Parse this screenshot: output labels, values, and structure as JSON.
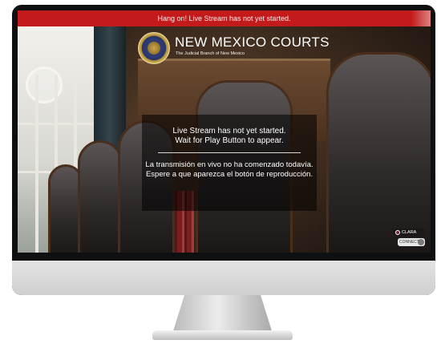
{
  "banner": {
    "text": "Hang on! Live Stream has not yet started."
  },
  "header": {
    "title": "NEW MEXICO COURTS",
    "subtitle": "The Judicial Branch of New Mexico"
  },
  "message": {
    "english_line1": "Live Stream has not yet started.",
    "english_line2": "Wait for Play Button to appear.",
    "spanish_line1": "La transmisión en vivo no ha comenzado todavía.",
    "spanish_line2": "Espere a que aparezca el botón de reproducción."
  },
  "widget": {
    "top_label": "CLARA",
    "bottom_label": "CONNECT"
  },
  "colors": {
    "banner": "#c31b1b",
    "monitor_bezel": "#0d0f11",
    "monitor_chin": "#dcdcdc"
  },
  "icons": {
    "seal": "new-mexico-courts-seal-icon",
    "widget": "clara-connect-icon"
  }
}
